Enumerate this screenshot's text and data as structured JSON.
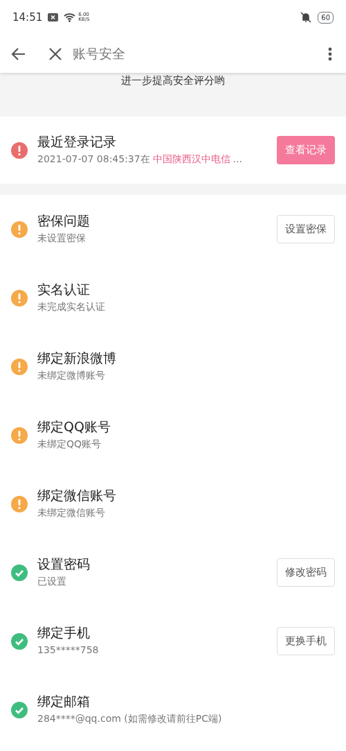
{
  "status_bar": {
    "time": "14:51",
    "speed_value": "6.00",
    "speed_unit": "KB/S",
    "battery": "60"
  },
  "header": {
    "title": "账号安全"
  },
  "hint": "进一步提高安全评分哟",
  "login_record": {
    "title": "最近登录记录",
    "time": "2021-07-07 08:45:37在",
    "location": "中国陕西汉中电信",
    "ellipsis": "...",
    "kind": "alert",
    "color": "#e96d6d",
    "button": "查看记录"
  },
  "items": [
    {
      "title": "密保问题",
      "subtitle": "未设置密保",
      "kind": "alert",
      "color": "#f5a949",
      "button": "设置密保"
    },
    {
      "title": "实名认证",
      "subtitle": "未完成实名认证",
      "kind": "alert",
      "color": "#f5a949"
    },
    {
      "title": "绑定新浪微博",
      "subtitle": "未绑定微博账号",
      "kind": "alert",
      "color": "#f5a949"
    },
    {
      "title": "绑定QQ账号",
      "subtitle": "未绑定QQ账号",
      "kind": "alert",
      "color": "#f5a949"
    },
    {
      "title": "绑定微信账号",
      "subtitle": "未绑定微信账号",
      "kind": "alert",
      "color": "#f5a949"
    },
    {
      "title": "设置密码",
      "subtitle": "已设置",
      "kind": "check",
      "color": "#3fbd7f",
      "button": "修改密码"
    },
    {
      "title": "绑定手机",
      "subtitle": "135*****758",
      "kind": "check",
      "color": "#3fbd7f",
      "button": "更换手机"
    },
    {
      "title": "绑定邮箱",
      "subtitle": "284****@qq.com (如需修改请前往PC端)",
      "kind": "check",
      "color": "#3fbd7f"
    }
  ]
}
